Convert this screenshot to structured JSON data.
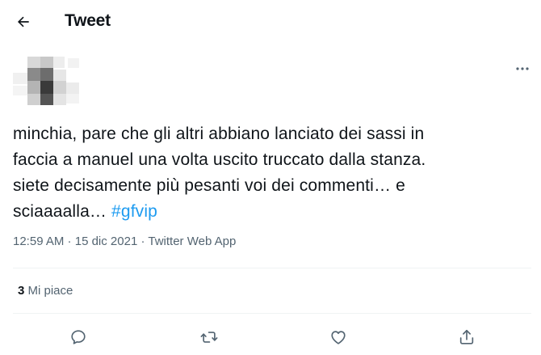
{
  "header": {
    "title": "Tweet",
    "back_icon": "arrow-left-icon"
  },
  "tweet": {
    "text_lines": [
      "minchia, pare che gli altri abbiano lanciato dei sassi in",
      "faccia a manuel una volta uscito truccato dalla stanza.",
      "siete decisamente più pesanti voi dei commenti… e",
      "sciaaaalla… "
    ],
    "hashtag": "#gfvip",
    "time": "12:59 AM",
    "separator": " · ",
    "date": "15 dic 2021",
    "source": "Twitter Web App"
  },
  "stats": {
    "likes_count": "3",
    "likes_label": " Mi piace"
  },
  "actions": {
    "reply_icon": "reply-icon",
    "retweet_icon": "retweet-icon",
    "like_icon": "heart-icon",
    "share_icon": "share-icon"
  },
  "colors": {
    "accent": "#1d9bf0",
    "text": "#0f1419",
    "secondary": "#536471",
    "divider": "#eff3f4"
  }
}
